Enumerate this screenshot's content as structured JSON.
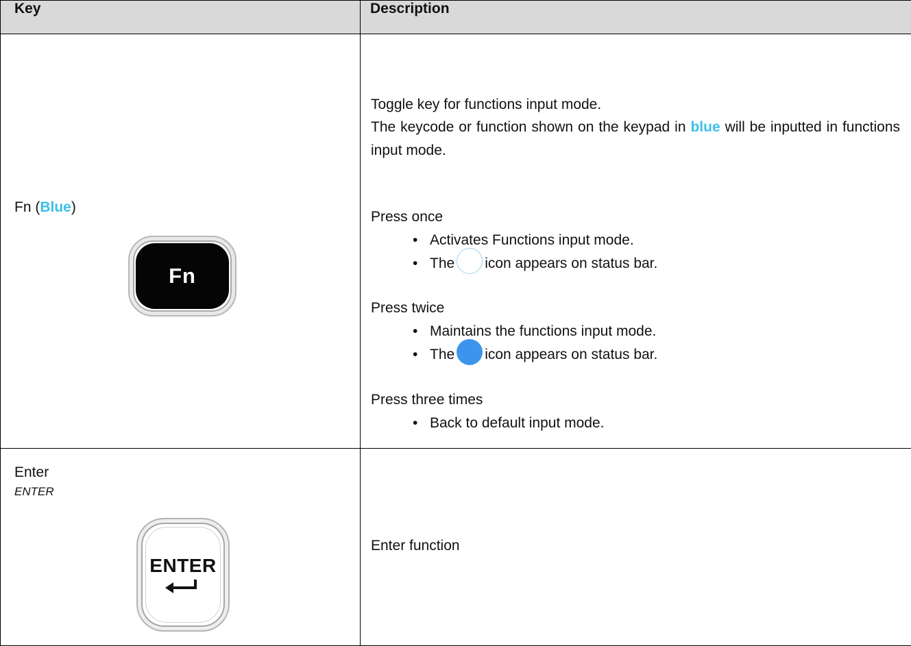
{
  "table": {
    "header": {
      "key": "Key",
      "description": "Description"
    },
    "fn_row": {
      "name": "Fn (",
      "name_color_word": "Blue",
      "name_close": ")",
      "keycap_label": "Fn",
      "line1": "Toggle key for functions input mode.",
      "line2_start": "The keycode or function shown on the keypad in ",
      "line2_color_word": "blue",
      "line2_end": " will be inputted in functions input mode.",
      "press_once": "Press once",
      "press_once_b1": "Activates Functions input mode.",
      "press_once_b2_before": "The",
      "press_once_b2_after": "icon appears on status bar.",
      "press_twice": "Press twice",
      "press_twice_b1": "Maintains the functions input mode.",
      "press_twice_b2_before": "The",
      "press_twice_b2_after": "icon appears on status bar.",
      "press_three": "Press three times",
      "press_three_b1": "Back to default input mode.",
      "bullet": "•"
    },
    "enter_row": {
      "name": "Enter",
      "subname": "ENTER",
      "keycap_label": "ENTER",
      "description": "Enter function"
    }
  },
  "colors": {
    "accent_blue_text": "#3cc0e6",
    "status_icon_fill": "#3d94ec",
    "header_bg": "#d9d9d9"
  }
}
